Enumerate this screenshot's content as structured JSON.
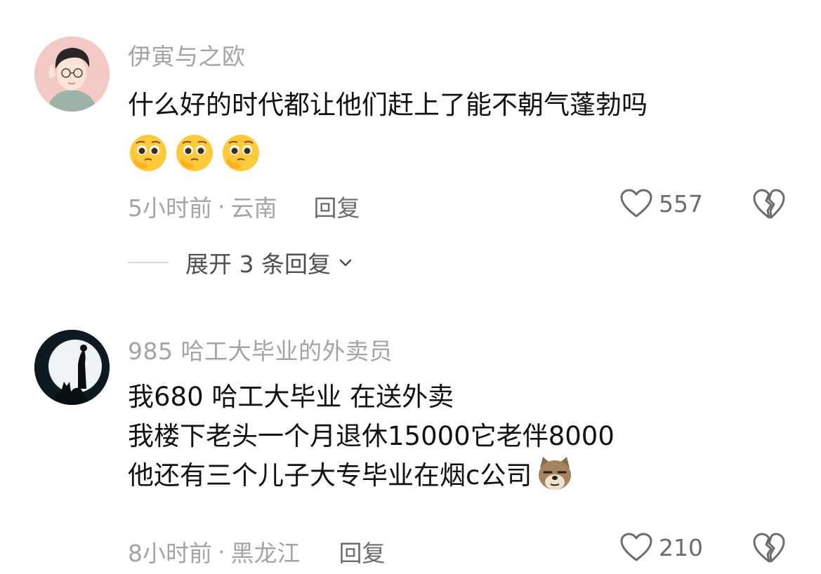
{
  "comments": [
    {
      "username": "伊寅与之欧",
      "lines": [
        "什么好的时代都让他们赶上了能不朝气蓬勃吗"
      ],
      "emoji_name": "pleading-face-emoji",
      "time": "5小时前",
      "location": "云南",
      "separator": "·",
      "reply_label": "回复",
      "like_count": "557",
      "expand_label": "展开 3 条回复"
    },
    {
      "username": "985 哈工大毕业的外卖员",
      "lines": [
        "我680 哈工大毕业 在送外卖",
        "我楼下老头一个月退休15000它老伴8000",
        "他还有三个儿子大专毕业在烟c公司"
      ],
      "emoji_name": "dog-emoji",
      "time": "8小时前",
      "location": "黑龙江",
      "separator": "·",
      "reply_label": "回复",
      "like_count": "210"
    }
  ],
  "colors": {
    "secondary_text": "#a3a3a8",
    "body_text": "#111111",
    "action_text": "#6b6b70"
  }
}
